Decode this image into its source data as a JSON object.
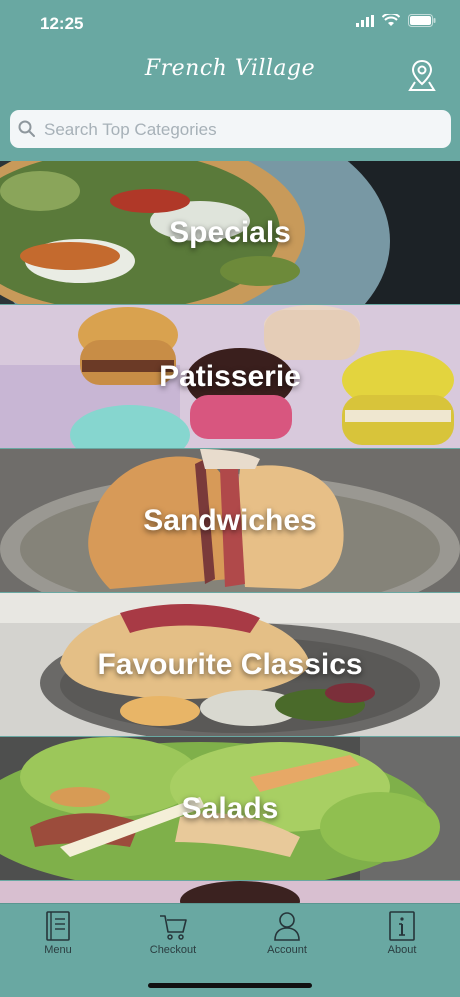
{
  "status": {
    "time": "12:25"
  },
  "header": {
    "title": "French Village"
  },
  "search": {
    "placeholder": "Search Top Categories"
  },
  "categories": [
    {
      "label": "Specials"
    },
    {
      "label": "Patisserie"
    },
    {
      "label": "Sandwiches"
    },
    {
      "label": "Favourite Classics"
    },
    {
      "label": "Salads"
    },
    {
      "label": ""
    }
  ],
  "tabs": [
    {
      "label": "Menu",
      "icon": "book-icon"
    },
    {
      "label": "Checkout",
      "icon": "cart-icon"
    },
    {
      "label": "Account",
      "icon": "person-icon"
    },
    {
      "label": "About",
      "icon": "info-icon"
    }
  ],
  "colors": {
    "brand": "#69a8a2",
    "tab_text": "#2b3d40",
    "search_bg": "#f3f6f8"
  }
}
